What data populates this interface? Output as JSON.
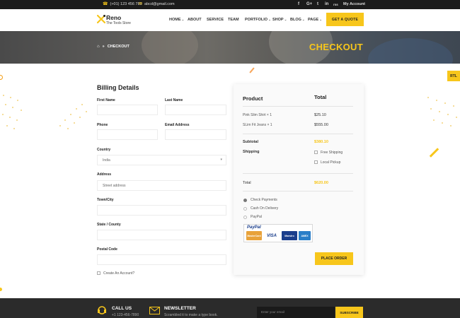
{
  "topbar": {
    "phone": "(+01) 123 456 789",
    "email": "abcd@gmail.com",
    "social": [
      "f",
      "G+",
      "t",
      "in",
      "rss"
    ],
    "account": "My Account"
  },
  "header": {
    "brand": "Reno",
    "tagline": "The Tools Store",
    "nav": [
      {
        "label": "HOME",
        "dropdown": true
      },
      {
        "label": "ABOUT",
        "dropdown": false
      },
      {
        "label": "SERVICE",
        "dropdown": false
      },
      {
        "label": "TEAM",
        "dropdown": false
      },
      {
        "label": "PORTFOLIO",
        "dropdown": true
      },
      {
        "label": "SHOP",
        "dropdown": true
      },
      {
        "label": "BLOG",
        "dropdown": true
      },
      {
        "label": "PAGE",
        "dropdown": true
      }
    ],
    "quote_button": "GET A QUOTE"
  },
  "banner": {
    "breadcrumb_current": "CHECKOUT",
    "title": "CHECKOUT"
  },
  "billing": {
    "title": "Billing Details",
    "first_name_label": "First Name",
    "last_name_label": "Last Name",
    "phone_label": "Phone",
    "email_label": "Email Address",
    "country_label": "Country",
    "country_value": "India",
    "address_label": "Address",
    "address_placeholder": "Street address",
    "city_label": "Town/City",
    "state_label": "State / County",
    "postal_label": "Postal Code",
    "create_account_label": "Create An Account?"
  },
  "order": {
    "product_header": "Product",
    "total_header": "Total",
    "items": [
      {
        "name": "Pink Slim Shirt × 1",
        "price": "$25.10"
      },
      {
        "name": "SLim Fit Jeans × 1",
        "price": "$555.00"
      }
    ],
    "subtotal_label": "Subtotal",
    "subtotal_value": "$380.10",
    "shipping_label": "Shipping",
    "shipping_options": [
      "Free Shipping",
      "Local Pickup"
    ],
    "total_label": "Total",
    "total_value": "$620.00",
    "payment_methods": [
      {
        "label": "Check Payments",
        "selected": true
      },
      {
        "label": "Cash On Delivery",
        "selected": false
      },
      {
        "label": "PayPal",
        "selected": false
      }
    ],
    "paypal_logo": "PayPal",
    "cards": [
      "MasterCard",
      "VISA",
      "Maestro",
      "AMEX"
    ],
    "place_order": "PLACE ORDER"
  },
  "rtl_label": "RTL",
  "footer": {
    "call_title": "CALL US",
    "call_number": "+1 123-456-7890",
    "newsletter_title": "NEWSLETTER",
    "newsletter_text": "Scrambled it to make a type book.",
    "email_placeholder": "Enter your email",
    "subscribe": "SUBSCRIBE"
  },
  "colors": {
    "accent": "#f7c61b",
    "topbar": "#1b1b1b",
    "footer": "#2b2b2b"
  }
}
